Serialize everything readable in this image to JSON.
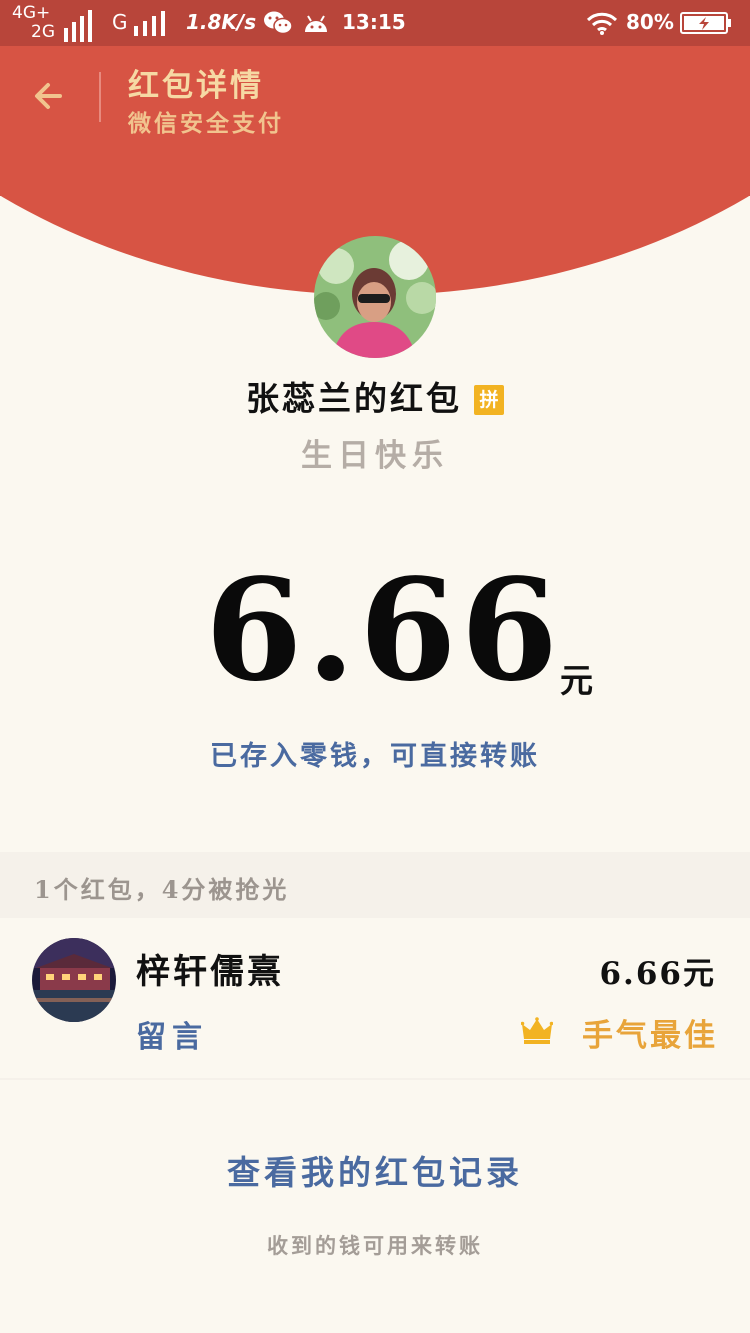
{
  "status_bar": {
    "network_primary": "4G+",
    "network_secondary": "2G",
    "carrier_g": "G",
    "speed": "1.8K/s",
    "time": "13:15",
    "battery": "80%",
    "icons": [
      "signal-icon",
      "wechat-icon",
      "android-icon",
      "wifi-icon",
      "battery-icon"
    ]
  },
  "header": {
    "title": "红包详情",
    "subtitle": "微信安全支付",
    "back_icon": "arrow-left-icon",
    "color": "#d75444"
  },
  "sender": {
    "name": "张蕊兰的红包",
    "badge": "拼",
    "greeting": "生日快乐"
  },
  "amount": {
    "value": "6.66",
    "unit": "元",
    "note": "已存入零钱，可直接转账"
  },
  "list": {
    "header": "1个红包，4分被抢光",
    "rows": [
      {
        "name": "梓轩儒熹",
        "amount": "6.66元",
        "message_label": "留言",
        "badge": "手气最佳",
        "badge_icon": "crown-icon"
      }
    ]
  },
  "records_link": "查看我的红包记录",
  "footer_note": "收到的钱可用来转账",
  "colors": {
    "accent_blue": "#4a6aa0",
    "gold": "#e8a43a",
    "background": "#fbf8f0"
  }
}
